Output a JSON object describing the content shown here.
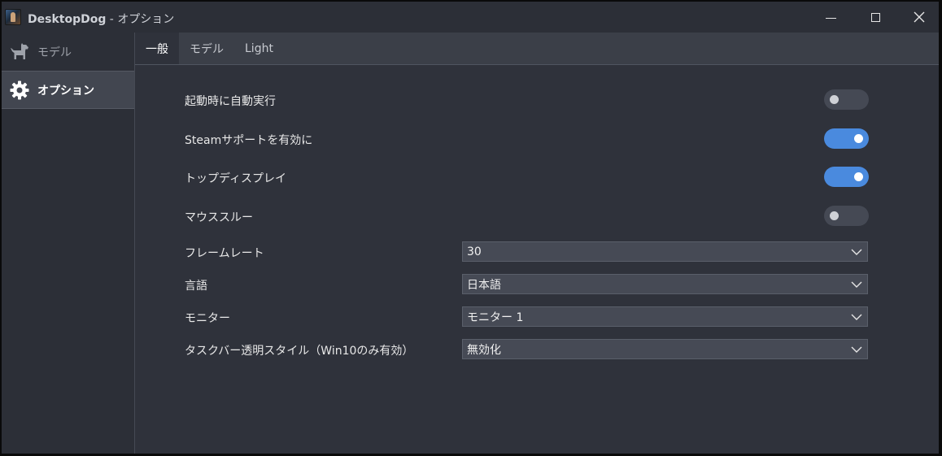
{
  "window": {
    "app_name": "DesktopDog",
    "separator": " - ",
    "page_name": "オプション"
  },
  "sidebar": {
    "items": [
      {
        "label": "モデル",
        "icon": "dog-icon",
        "active": false
      },
      {
        "label": "オプション",
        "icon": "gear-icon",
        "active": true
      }
    ]
  },
  "tabs": [
    {
      "label": "一般",
      "active": true
    },
    {
      "label": "モデル",
      "active": false
    },
    {
      "label": "Light",
      "active": false
    }
  ],
  "settings": {
    "autostart": {
      "label": "起動時に自動実行",
      "value": false
    },
    "steam": {
      "label": "Steamサポートを有効に",
      "value": true
    },
    "topdisplay": {
      "label": "トップディスプレイ",
      "value": true
    },
    "mousethrough": {
      "label": "マウススルー",
      "value": false
    },
    "framerate": {
      "label": "フレームレート",
      "value": "30"
    },
    "language": {
      "label": "言語",
      "value": "日本語"
    },
    "monitor": {
      "label": "モニター",
      "value": "モニター 1"
    },
    "taskbar": {
      "label": "タスクバー透明スタイル（Win10のみ有効）",
      "value": "無効化"
    }
  },
  "colors": {
    "accent": "#4a8ade",
    "background": "#2f323b",
    "sidebar": "#2c2f37"
  }
}
